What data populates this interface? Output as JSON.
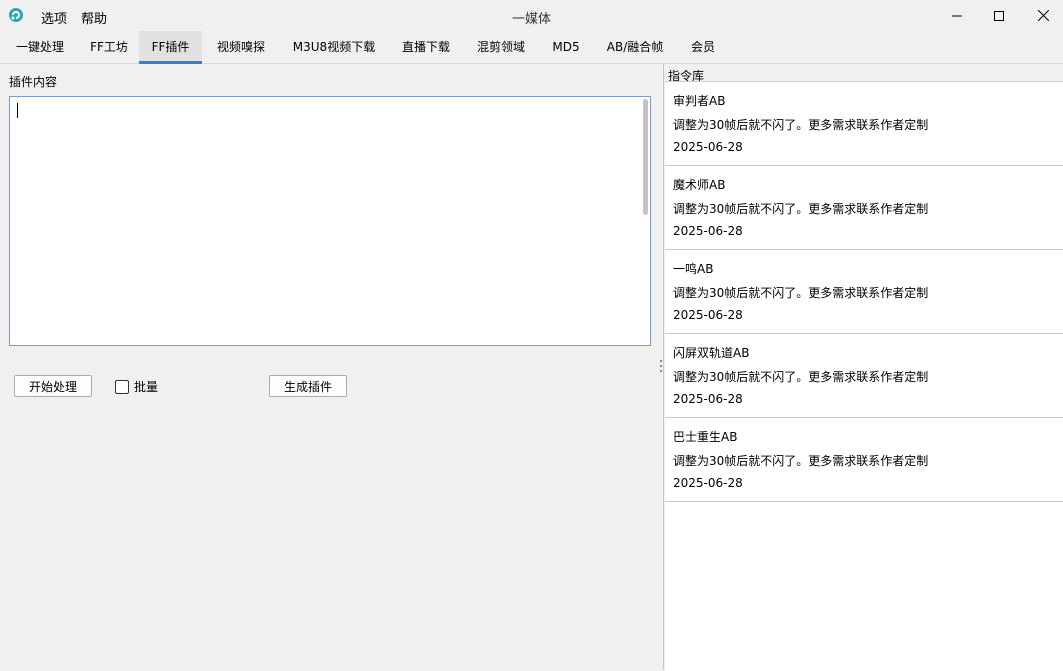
{
  "window": {
    "title": "一媒体",
    "menu": [
      "选项",
      "帮助"
    ]
  },
  "tabs": [
    {
      "label": "一键处理"
    },
    {
      "label": "FF工坊"
    },
    {
      "label": "FF插件"
    },
    {
      "label": "视频嗅探"
    },
    {
      "label": "M3U8视频下载"
    },
    {
      "label": "直播下载"
    },
    {
      "label": "混剪领域"
    },
    {
      "label": "MD5"
    },
    {
      "label": "AB/融合帧"
    },
    {
      "label": "会员"
    }
  ],
  "active_tab": "FF插件",
  "plugin": {
    "content_label": "插件内容",
    "content_value": "",
    "start_button": "开始处理",
    "batch_label": "批量",
    "batch_checked": false,
    "generate_button": "生成插件"
  },
  "library": {
    "title": "指令库",
    "items": [
      {
        "title": "审判者AB",
        "desc": "调整为30帧后就不闪了。更多需求联系作者定制",
        "date": "2025-06-28"
      },
      {
        "title": "魔术师AB",
        "desc": "调整为30帧后就不闪了。更多需求联系作者定制",
        "date": "2025-06-28"
      },
      {
        "title": "一鸣AB",
        "desc": "调整为30帧后就不闪了。更多需求联系作者定制",
        "date": "2025-06-28"
      },
      {
        "title": "闪屏双轨道AB",
        "desc": "调整为30帧后就不闪了。更多需求联系作者定制",
        "date": "2025-06-28"
      },
      {
        "title": "巴士重生AB",
        "desc": "调整为30帧后就不闪了。更多需求联系作者定制",
        "date": "2025-06-28"
      }
    ]
  },
  "colors": {
    "accent": "#3a7ccf",
    "tab_active_bg": "#e1e1e1",
    "window_bg": "#f0f0f0"
  },
  "icons": {
    "app": "app-logo-icon",
    "minimize": "minimize-icon",
    "maximize": "maximize-icon",
    "close": "close-icon"
  }
}
